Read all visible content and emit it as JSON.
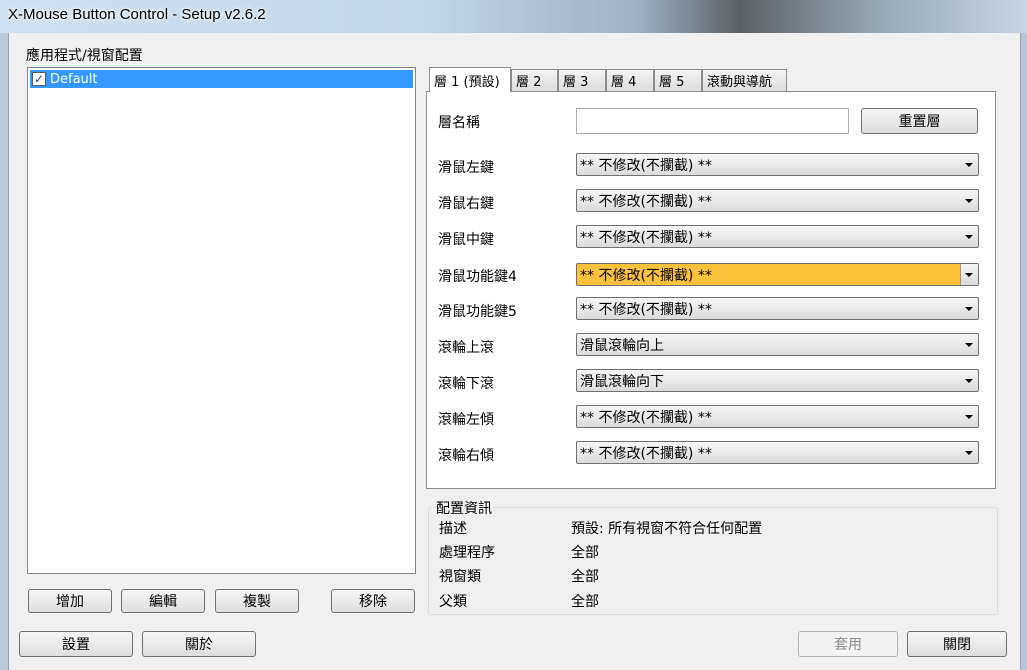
{
  "window": {
    "title": "X-Mouse Button Control - Setup v2.6.2"
  },
  "app_group": {
    "label": "應用程式/視窗配置",
    "items": [
      {
        "label": "Default",
        "checked": true
      }
    ],
    "buttons": {
      "add": "增加",
      "edit": "編輯",
      "copy": "複製",
      "remove": "移除"
    }
  },
  "tabs": [
    {
      "label": "層 1 (預設)",
      "active": true
    },
    {
      "label": "層 2"
    },
    {
      "label": "層 3"
    },
    {
      "label": "層 4"
    },
    {
      "label": "層 5"
    },
    {
      "label": "滾動與導航"
    }
  ],
  "layer": {
    "name_label": "層名稱",
    "name_value": "",
    "reset_label": "重置層",
    "rows": [
      {
        "label": "滑鼠左鍵",
        "value": "** 不修改(不攔截) **"
      },
      {
        "label": "滑鼠右鍵",
        "value": "** 不修改(不攔截) **"
      },
      {
        "label": "滑鼠中鍵",
        "value": "** 不修改(不攔截) **"
      },
      {
        "label": "滑鼠功能鍵4",
        "value": "** 不修改(不攔截) **",
        "highlighted": true
      },
      {
        "label": "滑鼠功能鍵5",
        "value": "** 不修改(不攔截) **"
      },
      {
        "label": "滾輪上滾",
        "value": "滑鼠滾輪向上"
      },
      {
        "label": "滾輪下滾",
        "value": "滑鼠滾輪向下"
      },
      {
        "label": "滾輪左傾",
        "value": "** 不修改(不攔截) **"
      },
      {
        "label": "滾輪右傾",
        "value": "** 不修改(不攔截) **"
      }
    ]
  },
  "config_info": {
    "label": "配置資訊",
    "rows": [
      {
        "key": "描述",
        "value": "預設: 所有視窗不符合任何配置"
      },
      {
        "key": "處理程序",
        "value": "全部"
      },
      {
        "key": "視窗類",
        "value": "全部"
      },
      {
        "key": "父類",
        "value": "全部"
      }
    ]
  },
  "footer": {
    "settings": "設置",
    "about": "關於",
    "apply": "套用",
    "close": "關閉"
  },
  "colors": {
    "selection": "#3399ff",
    "highlight_combo": "#fdc23c"
  }
}
